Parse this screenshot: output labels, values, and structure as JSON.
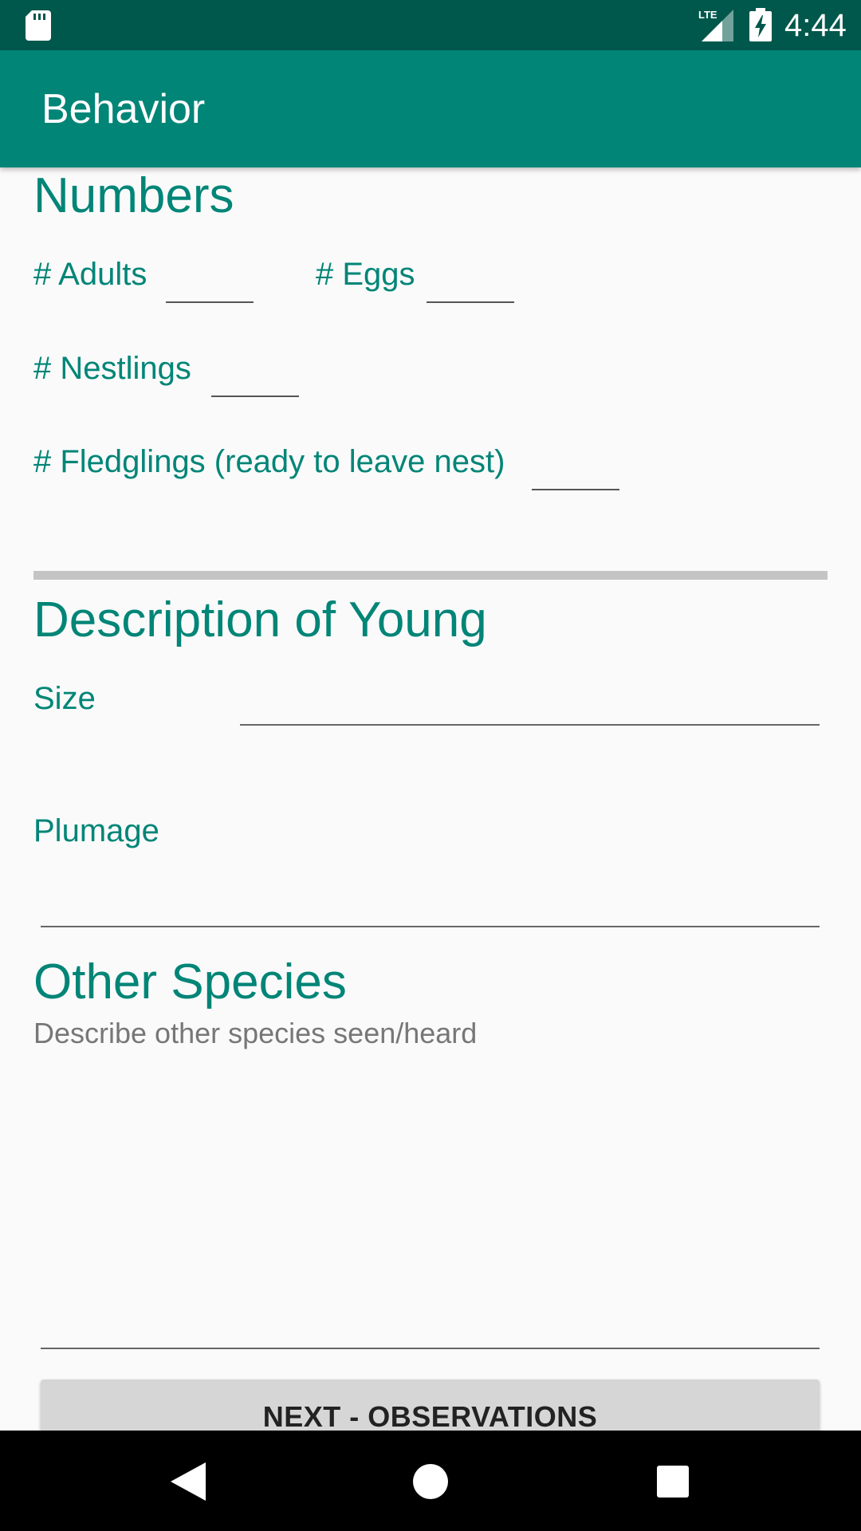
{
  "status_bar": {
    "network": "LTE",
    "time": "4:44"
  },
  "app_bar": {
    "title": "Behavior"
  },
  "numbers": {
    "heading": "Numbers",
    "adults_label": "# Adults",
    "eggs_label": "# Eggs",
    "nestlings_label": "# Nestlings",
    "fledglings_label": "# Fledglings (ready to leave nest)"
  },
  "young": {
    "heading": "Description of Young",
    "size_label": "Size",
    "plumage_label": "Plumage"
  },
  "other_species": {
    "heading": "Other Species",
    "hint": "Describe other species seen/heard"
  },
  "next_button": {
    "label": "NEXT - OBSERVATIONS"
  },
  "colors": {
    "primary": "#008577",
    "primary_dark": "#00574b",
    "background": "#fafafa"
  },
  "icons": {
    "status": [
      "sd-card-icon",
      "lte-signal-icon",
      "battery-charging-icon"
    ],
    "nav": [
      "back-icon",
      "home-icon",
      "recents-icon"
    ]
  }
}
